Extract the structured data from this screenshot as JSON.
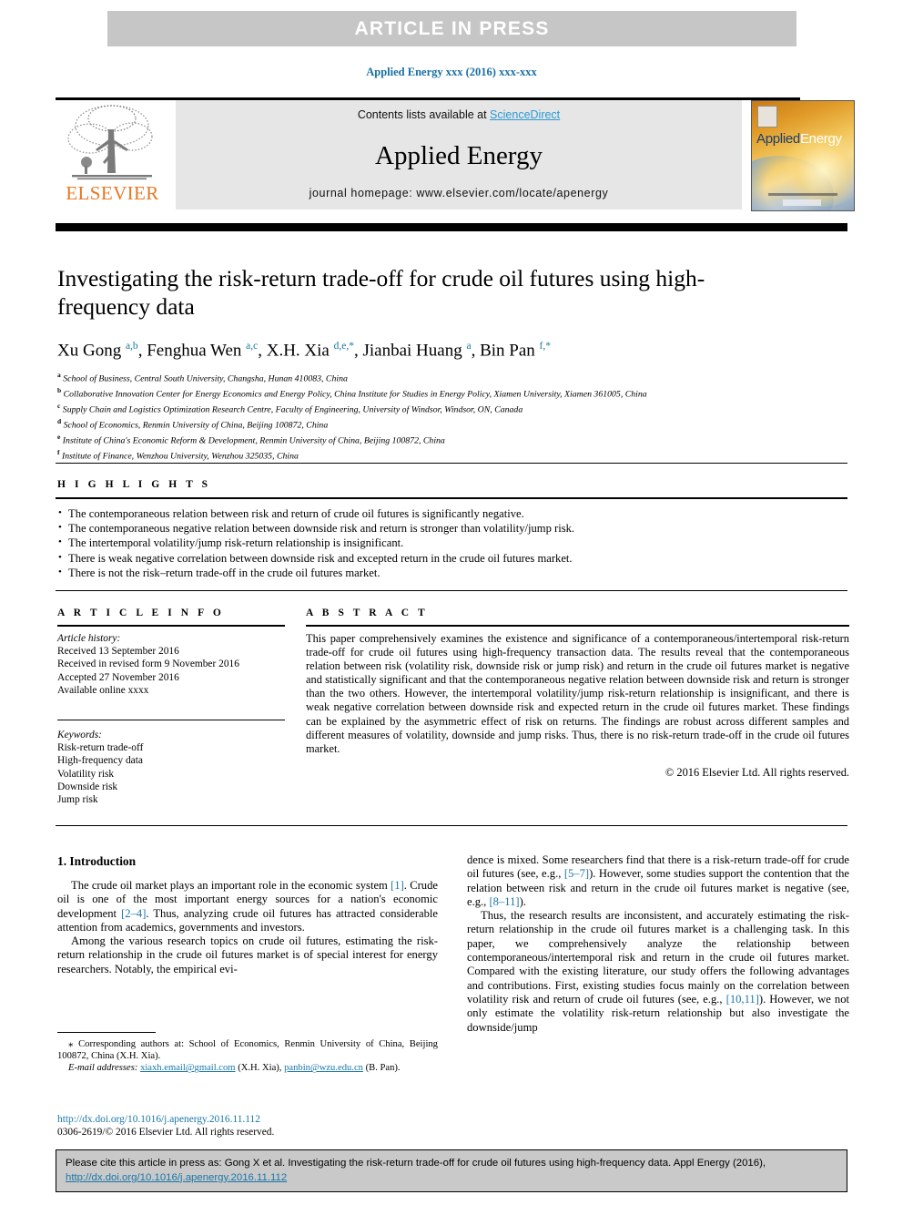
{
  "banner": {
    "text": "ARTICLE  IN  PRESS"
  },
  "running_head": "Applied Energy xxx (2016) xxx-xxx",
  "masthead": {
    "contents_prefix": "Contents lists available at ",
    "sciencedirect": "ScienceDirect",
    "journal_title": "Applied Energy",
    "homepage": "journal homepage: www.elsevier.com/locate/apenergy",
    "publisher": "ELSEVIER",
    "cover_title_part1": "Applied",
    "cover_title_part2": "Energy"
  },
  "article": {
    "title": "Investigating the risk-return trade-off for crude oil futures using high-frequency data",
    "authors_html": "Xu Gong <sup>a,b</sup>, Fenghua Wen <sup>a,c</sup>, X.H. Xia <sup>d,e,</sup><sup>*</sup>, Jianbai Huang <sup>a</sup>, Bin Pan <sup>f,</sup><sup>*</sup>",
    "affiliations": [
      {
        "mark": "a",
        "text": "School of Business, Central South University, Changsha, Hunan 410083, China"
      },
      {
        "mark": "b",
        "text": "Collaborative Innovation Center for Energy Economics and Energy Policy, China Institute for Studies in Energy Policy, Xiamen University, Xiamen 361005, China"
      },
      {
        "mark": "c",
        "text": "Supply Chain and Logistics Optimization Research Centre, Faculty of Engineering, University of Windsor, Windsor, ON, Canada"
      },
      {
        "mark": "d",
        "text": "School of Economics, Renmin University of China, Beijing 100872, China"
      },
      {
        "mark": "e",
        "text": "Institute of China's Economic Reform & Development, Renmin University of China, Beijing 100872, China"
      },
      {
        "mark": "f",
        "text": "Institute of Finance, Wenzhou University, Wenzhou 325035, China"
      }
    ]
  },
  "highlights": {
    "heading": "H I G H L I G H T S",
    "items": [
      "The contemporaneous relation between risk and return of crude oil futures is significantly negative.",
      "The contemporaneous negative relation between downside risk and return is stronger than volatility/jump risk.",
      "The intertemporal volatility/jump risk-return relationship is insignificant.",
      "There is weak negative correlation between downside risk and excepted return in the crude oil futures market.",
      "There is not the risk–return trade-off in the crude oil futures market."
    ]
  },
  "article_info": {
    "heading": "A R T I C L E   I N F O",
    "history_label": "Article history:",
    "history": [
      "Received 13 September 2016",
      "Received in revised form 9 November 2016",
      "Accepted 27 November 2016",
      "Available online xxxx"
    ],
    "keywords_label": "Keywords:",
    "keywords": [
      "Risk-return trade-off",
      "High-frequency data",
      "Volatility risk",
      "Downside risk",
      "Jump risk"
    ]
  },
  "abstract": {
    "heading": "A B S T R A C T",
    "text": "This paper comprehensively examines the existence and significance of a contemporaneous/intertemporal risk-return trade-off for crude oil futures using high-frequency transaction data. The results reveal that the contemporaneous relation between risk (volatility risk, downside risk or jump risk) and return in the crude oil futures market is negative and statistically significant and that the contemporaneous negative relation between downside risk and return is stronger than the two others. However, the intertemporal volatility/jump risk-return relationship is insignificant, and there is weak negative correlation between downside risk and expected return in the crude oil futures market. These findings can be explained by the asymmetric effect of risk on returns. The findings are robust across different samples and different measures of volatility, downside and jump risks. Thus, there is no risk-return trade-off in the crude oil futures market.",
    "copyright": "© 2016 Elsevier Ltd. All rights reserved."
  },
  "body": {
    "section_heading": "1. Introduction",
    "left_paragraphs": [
      "The crude oil market plays an important role in the economic system [1]. Crude oil is one of the most important energy sources for a nation's economic development [2–4]. Thus, analyzing crude oil futures has attracted considerable attention from academics, governments and investors.",
      "Among the various research topics on crude oil futures, estimating the risk-return relationship in the crude oil futures market is of special interest for energy researchers. Notably, the empirical evi-"
    ],
    "right_paragraphs": [
      "dence is mixed. Some researchers find that there is a risk-return trade-off for crude oil futures (see, e.g., [5–7]). However, some studies support the contention that the relation between risk and return in the crude oil futures market is negative (see, e.g., [8–11]).",
      "Thus, the research results are inconsistent, and accurately estimating the risk-return relationship in the crude oil futures market is a challenging task. In this paper, we comprehensively analyze the relationship between contemporaneous/intertemporal risk and return in the crude oil futures market. Compared with the existing literature, our study offers the following advantages and contributions. First, existing studies focus mainly on the correlation between volatility risk and return of crude oil futures (see, e.g., [10,11]). However, we not only estimate the volatility risk-return relationship but also investigate the downside/jump"
    ],
    "refs_left": [
      "[1]",
      "[2–4]"
    ],
    "refs_right": [
      "[5–7]",
      "[8–11]",
      "[10,11]"
    ]
  },
  "footnote": {
    "star": "⁎",
    "corresponding": "Corresponding authors at: School of Economics, Renmin University of China, Beijing 100872, China (X.H. Xia).",
    "email_label": "E-mail addresses:",
    "email1": "xiaxh.email@gmail.com",
    "email1_who": "(X.H. Xia),",
    "email2": "panbin@wzu.edu.cn",
    "email2_who": "(B. Pan)."
  },
  "doi": {
    "url": "http://dx.doi.org/10.1016/j.apenergy.2016.11.112",
    "issn": "0306-2619/© 2016 Elsevier Ltd. All rights reserved."
  },
  "cite_box": {
    "text": "Please cite this article in press as: Gong X et al. Investigating the risk-return trade-off for crude oil futures using high-frequency data. Appl Energy (2016),",
    "link": "http://dx.doi.org/10.1016/j.apenergy.2016.11.112"
  },
  "colors": {
    "banner_bg": "#c6c6c6",
    "link_blue": "#1a77a8",
    "sd_blue": "#2b9ad6",
    "elsevier_orange": "#e87722",
    "mast_bg": "#e6e6e6",
    "cite_bg": "#c9c9c9"
  }
}
